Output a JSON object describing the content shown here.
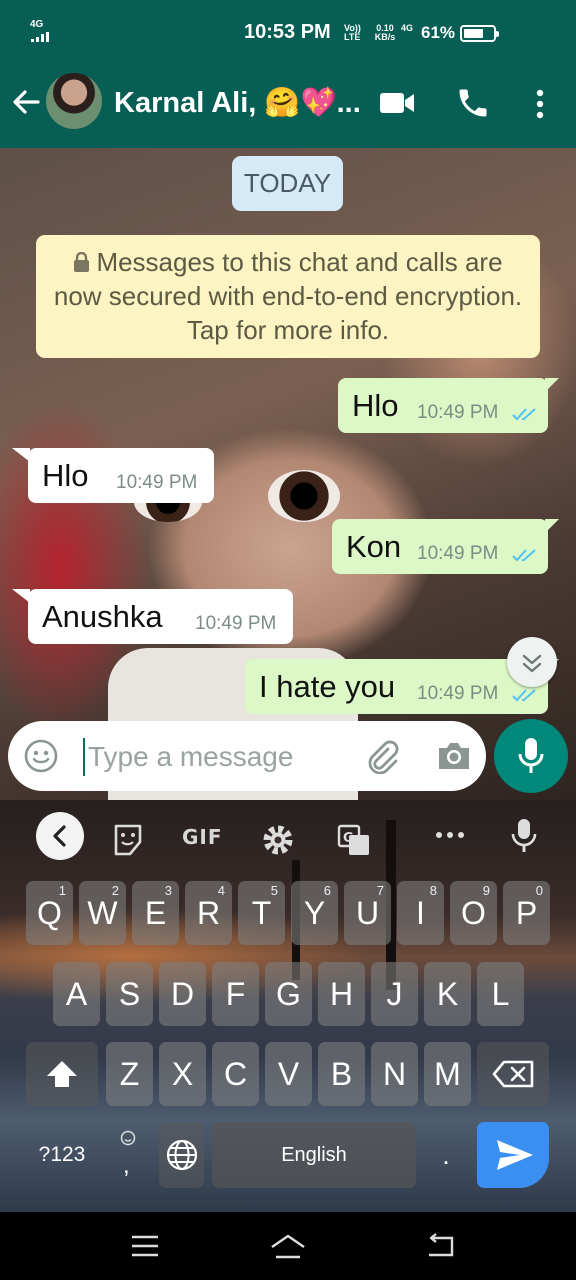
{
  "status_bar": {
    "network": "4G",
    "time": "10:53 PM",
    "volte": "Vo)) LTE",
    "speed": "0.10 KB/s",
    "net_type": "4G",
    "battery": "61%"
  },
  "header": {
    "contact_name": "Karnal Ali, 🤗💖...",
    "icons": [
      "back-arrow-icon",
      "avatar",
      "video-call-icon",
      "phone-icon",
      "more-options-icon"
    ]
  },
  "chat": {
    "date_label": "TODAY",
    "encryption_notice": "Messages to this chat and calls are now secured with end-to-end encryption. Tap for more info.",
    "messages": [
      {
        "direction": "out",
        "text": "Hlo",
        "time": "10:49 PM",
        "status": "read"
      },
      {
        "direction": "in",
        "text": "Hlo",
        "time": "10:49 PM"
      },
      {
        "direction": "out",
        "text": "Kon",
        "time": "10:49 PM",
        "status": "read"
      },
      {
        "direction": "in",
        "text": "Anushka",
        "time": "10:49 PM"
      },
      {
        "direction": "out",
        "text": "I hate you",
        "time": "10:49 PM",
        "status": "read"
      }
    ]
  },
  "input": {
    "placeholder": "Type a message"
  },
  "keyboard": {
    "toolbar": {
      "gif_label": "GIF"
    },
    "row1": [
      {
        "key": "Q",
        "hint": "1"
      },
      {
        "key": "W",
        "hint": "2"
      },
      {
        "key": "E",
        "hint": "3"
      },
      {
        "key": "R",
        "hint": "4"
      },
      {
        "key": "T",
        "hint": "5"
      },
      {
        "key": "Y",
        "hint": "6"
      },
      {
        "key": "U",
        "hint": "7"
      },
      {
        "key": "I",
        "hint": "8"
      },
      {
        "key": "O",
        "hint": "9"
      },
      {
        "key": "P",
        "hint": "0"
      }
    ],
    "row2": [
      "A",
      "S",
      "D",
      "F",
      "G",
      "H",
      "J",
      "K",
      "L"
    ],
    "row3": [
      "Z",
      "X",
      "C",
      "V",
      "B",
      "N",
      "M"
    ],
    "symbols_label": "?123",
    "comma_label": ",",
    "space_label": "English",
    "period_label": "."
  },
  "accent_colors": {
    "header": "#075e54",
    "outgoing_bubble": "#dcf8c6",
    "mic_button": "#00897b",
    "read_ticks": "#4fc3f7",
    "send_key": "#3a8ff0"
  }
}
